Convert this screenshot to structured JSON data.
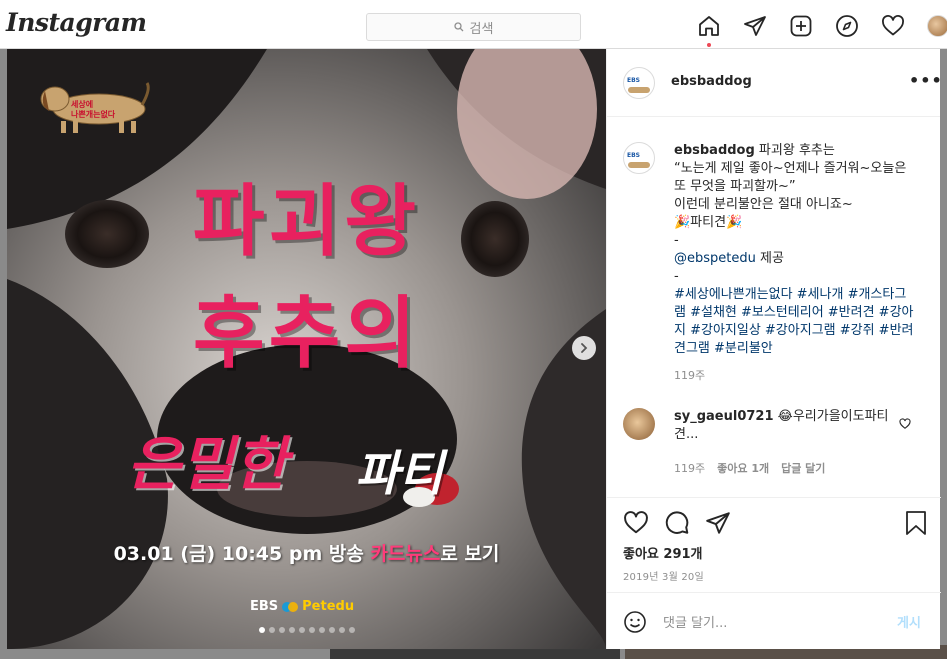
{
  "nav": {
    "logo": "Instagram",
    "search_placeholder": "검색"
  },
  "post": {
    "image_text": {
      "badge": "세상에 나쁜개는없다",
      "line1": "파괴왕",
      "line2": "후추의",
      "line3": "은밀한",
      "line4": "파티",
      "broadcast_pre": "03.01 (금) 10:45 pm 방송 ",
      "broadcast_hl": "카드뉴스",
      "broadcast_post": "로 보기",
      "logo_ebs": "EBS",
      "logo_pet": "Petedu"
    },
    "carousel": {
      "count": 10,
      "active": 0
    }
  },
  "panel": {
    "username": "ebsbaddog",
    "more_label": "•••",
    "caption": {
      "username": "ebsbaddog",
      "lines": [
        " 파괴왕 후추는",
        "“노는게 제일 좋아~언제나 즐거워~오늘은 또 무엇을 파괴할까~”",
        "이런데 분리불안은 절대 아니죠~",
        "🎉파티견🎉",
        "-"
      ],
      "mention": "@ebspetedu",
      "mention_suffix": " 제공",
      "dash": "-",
      "hashtags": "#세상에나쁜개는없다 #세나개 #개스타그램 #설채현 #보스턴테리어 #반려견 #강아지 #강아지일상 #강아지그램 #강쥐 #반려견그램 #분리불안",
      "time": "119주"
    },
    "reply": {
      "username": "sy_gaeul0721",
      "text": " 😂우리가을이도파티견...",
      "time": "119주",
      "likes": "좋아요 1개",
      "reply_label": "답글 달기"
    },
    "likes": "좋아요 291개",
    "date": "2019년 3월 20일",
    "comment_placeholder": "댓글 달기...",
    "post_label": "게시"
  }
}
